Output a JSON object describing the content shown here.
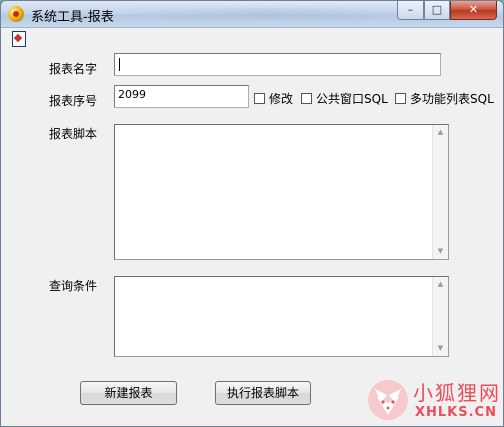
{
  "window": {
    "title": "系统工具-报表",
    "controls": {
      "minimize": "–",
      "maximize": "□",
      "close": "✕"
    }
  },
  "form": {
    "name_label": "报表名字",
    "name_value": "",
    "seq_label": "报表序号",
    "seq_value": "2099",
    "checkboxes": [
      {
        "label": "修改",
        "checked": false
      },
      {
        "label": "公共窗口SQL",
        "checked": false
      },
      {
        "label": "多功能列表SQL",
        "checked": false
      }
    ],
    "script_label": "报表脚本",
    "script_value": "",
    "condition_label": "查询条件",
    "condition_value": ""
  },
  "buttons": {
    "new_report": "新建报表",
    "run_script": "执行报表脚本"
  },
  "scroll_arrows": {
    "up": "▲",
    "down": "▼"
  },
  "watermark": {
    "text_cn": "小狐狸网",
    "text_en": "XHLKS.CN",
    "color": "#e94e5a"
  },
  "icons": {
    "app": "app-logo-icon",
    "system_menu": "report-doc-icon"
  }
}
